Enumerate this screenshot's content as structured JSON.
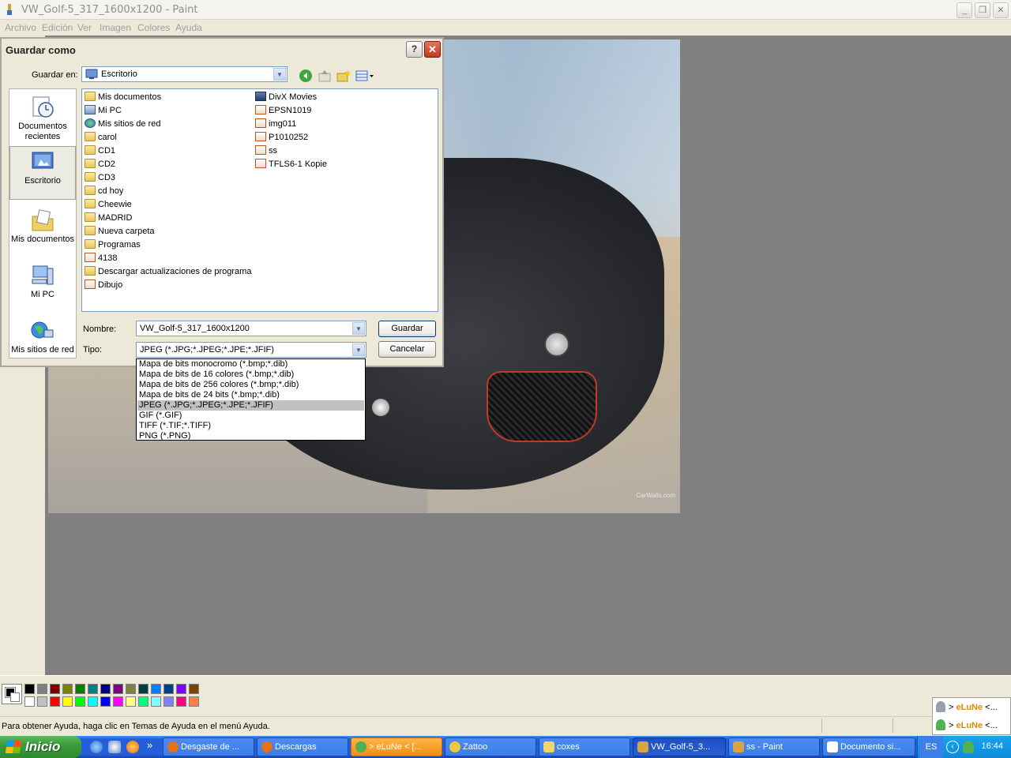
{
  "window": {
    "title": "VW_Golf-5_317_1600x1200 - Paint",
    "menu": [
      "Archivo",
      "Edición",
      "Ver",
      "Imagen",
      "Colores",
      "Ayuda"
    ]
  },
  "photo": {
    "watermark": "CarWalls.com"
  },
  "dialog": {
    "title": "Guardar como",
    "help": "?",
    "close": "✕",
    "save_in_label": "Guardar en:",
    "save_in_value": "Escritorio",
    "places": [
      {
        "label": "Documentos recientes"
      },
      {
        "label": "Escritorio"
      },
      {
        "label": "Mis documentos"
      },
      {
        "label": "Mi PC"
      },
      {
        "label": "Mis sitios de red"
      }
    ],
    "files_col1": [
      {
        "name": "Mis documentos",
        "icon": "docs-folder-icon"
      },
      {
        "name": "Mi PC",
        "icon": "computer-icon"
      },
      {
        "name": "Mis sitios de red",
        "icon": "network-icon"
      },
      {
        "name": "carol",
        "icon": "folder-icon"
      },
      {
        "name": "CD1",
        "icon": "folder-icon"
      },
      {
        "name": "CD2",
        "icon": "folder-icon"
      },
      {
        "name": "CD3",
        "icon": "folder-icon"
      },
      {
        "name": "cd hoy",
        "icon": "folder-icon"
      },
      {
        "name": "Cheewie",
        "icon": "folder-icon"
      },
      {
        "name": "MADRID",
        "icon": "folder-icon"
      },
      {
        "name": "Nueva carpeta",
        "icon": "folder-icon"
      },
      {
        "name": "Programas",
        "icon": "folder-icon"
      },
      {
        "name": "4138",
        "icon": "image-file-icon"
      },
      {
        "name": "Descargar actualizaciones de programa",
        "icon": "shortcut-folder-icon"
      },
      {
        "name": "Dibujo",
        "icon": "image-file-icon"
      }
    ],
    "files_col2": [
      {
        "name": "DivX Movies",
        "icon": "shortcut-icon"
      },
      {
        "name": "EPSN1019",
        "icon": "image-file-icon"
      },
      {
        "name": "img011",
        "icon": "image-file-icon"
      },
      {
        "name": "P1010252",
        "icon": "image-file-icon"
      },
      {
        "name": "ss",
        "icon": "image-file-icon"
      },
      {
        "name": "TFLS6-1 Kopie",
        "icon": "image-file-icon"
      }
    ],
    "name_label": "Nombre:",
    "name_value": "VW_Golf-5_317_1600x1200",
    "type_label": "Tipo:",
    "type_value": "JPEG (*.JPG;*.JPEG;*.JPE;*.JFIF)",
    "save_button": "Guardar",
    "cancel_button": "Cancelar",
    "type_options": [
      "Mapa de bits monocromo (*.bmp;*.dib)",
      "Mapa de bits de 16 colores (*.bmp;*.dib)",
      "Mapa de bits de 256 colores (*.bmp;*.dib)",
      "Mapa de bits de 24 bits (*.bmp;*.dib)",
      "JPEG (*.JPG;*.JPEG;*.JPE;*.JFIF)",
      "GIF (*.GIF)",
      "TIFF (*.TIF;*.TIFF)",
      "PNG (*.PNG)"
    ],
    "type_selected_index": 4
  },
  "palette": {
    "top": [
      "#000000",
      "#808080",
      "#800000",
      "#808000",
      "#008000",
      "#008080",
      "#000080",
      "#800080",
      "#808040",
      "#004040",
      "#0080ff",
      "#004080",
      "#8000ff",
      "#804000"
    ],
    "bottom": [
      "#ffffff",
      "#c0c0c0",
      "#ff0000",
      "#ffff00",
      "#00ff00",
      "#00ffff",
      "#0000ff",
      "#ff00ff",
      "#ffff80",
      "#00ff80",
      "#80ffff",
      "#8080ff",
      "#ff0080",
      "#ff8040"
    ]
  },
  "status": {
    "text": "Para obtener Ayuda, haga clic en Temas de Ayuda en el menú Ayuda."
  },
  "notifications": [
    {
      "prefix": "> ",
      "name": "eLuNe",
      "suffix": " <..."
    },
    {
      "prefix": "> ",
      "name": "eLuNe",
      "suffix": " <..."
    }
  ],
  "taskbar": {
    "start": "Inicio",
    "more": "»",
    "tasks": [
      {
        "label": "Desgaste de ...",
        "color": "#e8701a"
      },
      {
        "label": "Descargas",
        "color": "#e8701a"
      },
      {
        "label": "> eLuNe < [...",
        "color": "#4fb14f"
      },
      {
        "label": "Zattoo",
        "color": "#f5c542"
      },
      {
        "label": "coxes",
        "color": "#f2d46b"
      },
      {
        "label": "VW_Golf-5_3...",
        "color": "#d9a441"
      },
      {
        "label": "ss - Paint",
        "color": "#d9a441"
      },
      {
        "label": "Documento si...",
        "color": "#ffffff"
      }
    ],
    "lang": "ES",
    "clock": "16:44"
  }
}
